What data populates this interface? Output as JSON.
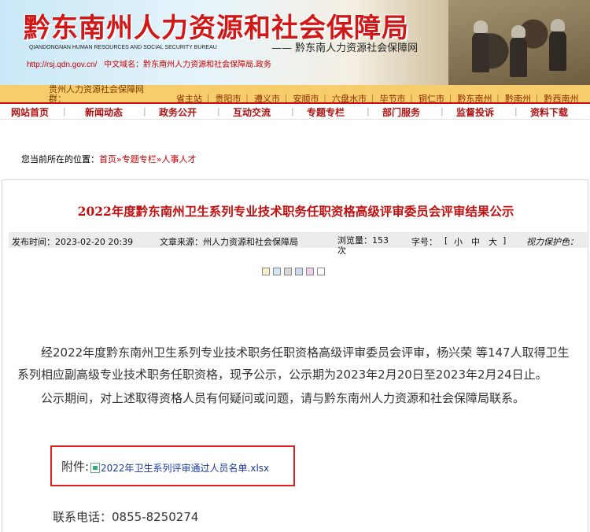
{
  "banner": {
    "title": "黔东南州人力资源和社会保障局",
    "en_line1": "QIANDONGNAN HUMAN RESOURCES AND SOCIAL SECURITY BUREAU",
    "slogan": "—— 黔东南人力资源社会保障网",
    "url": "http://rsj.qdn.gov.cn/",
    "cn_domain": "中文域名：黔东南州人力资源和社会保障局.政务"
  },
  "strip": {
    "left": "贵州人力资源社会保障网群：",
    "links": [
      "省主站",
      "贵阳市",
      "遵义市",
      "安顺市",
      "六盘水市",
      "毕节市",
      "铜仁市",
      "黔东南州",
      "黔南州",
      "黔西南州"
    ]
  },
  "nav": {
    "items": [
      "网站首页",
      "新闻动态",
      "政务公开",
      "互动交流",
      "专题专栏",
      "部门服务",
      "监督投诉",
      "资料下载"
    ]
  },
  "breadcrumb": {
    "prefix": "您当前所在的位置：",
    "home": "首页",
    "section": "专题专栏",
    "sub": "人事人才"
  },
  "article": {
    "title": "2022年度黔东南州卫生系列专业技术职务任职资格高级评审委员会评审结果公示",
    "publish_time": "发布时间：2023-02-20 20:39",
    "source": "文章来源：州人力资源和社会保障局",
    "views": "浏览量：153 次",
    "font_size_label": "字号：",
    "font_small": "小",
    "font_mid": "中",
    "font_large": "大",
    "eye_protect": "视力保护色：",
    "swatches": [
      "#f5eec9",
      "#cfe7f5",
      "#d7d7d7",
      "#c9d9f0",
      "#eed0ee",
      "#ffffff"
    ],
    "para1": "经2022年度黔东南州卫生系列专业技术职务任职资格高级评审委员会评审，杨兴荣 等147人取得卫生系列相应副高级专业技术职务任职资格，现予公示，公示期为2023年2月20日至2023年2月24日止。",
    "para2": "公示期间，对上述取得资格人员有何疑问或问题，请与黔东南州人力资源和社会保障局联系。",
    "attach_label": "附件:",
    "attach_file": "2022年卫生系列评审通过人员名单.xlsx",
    "phone": "联系电话：0855-8250274"
  }
}
